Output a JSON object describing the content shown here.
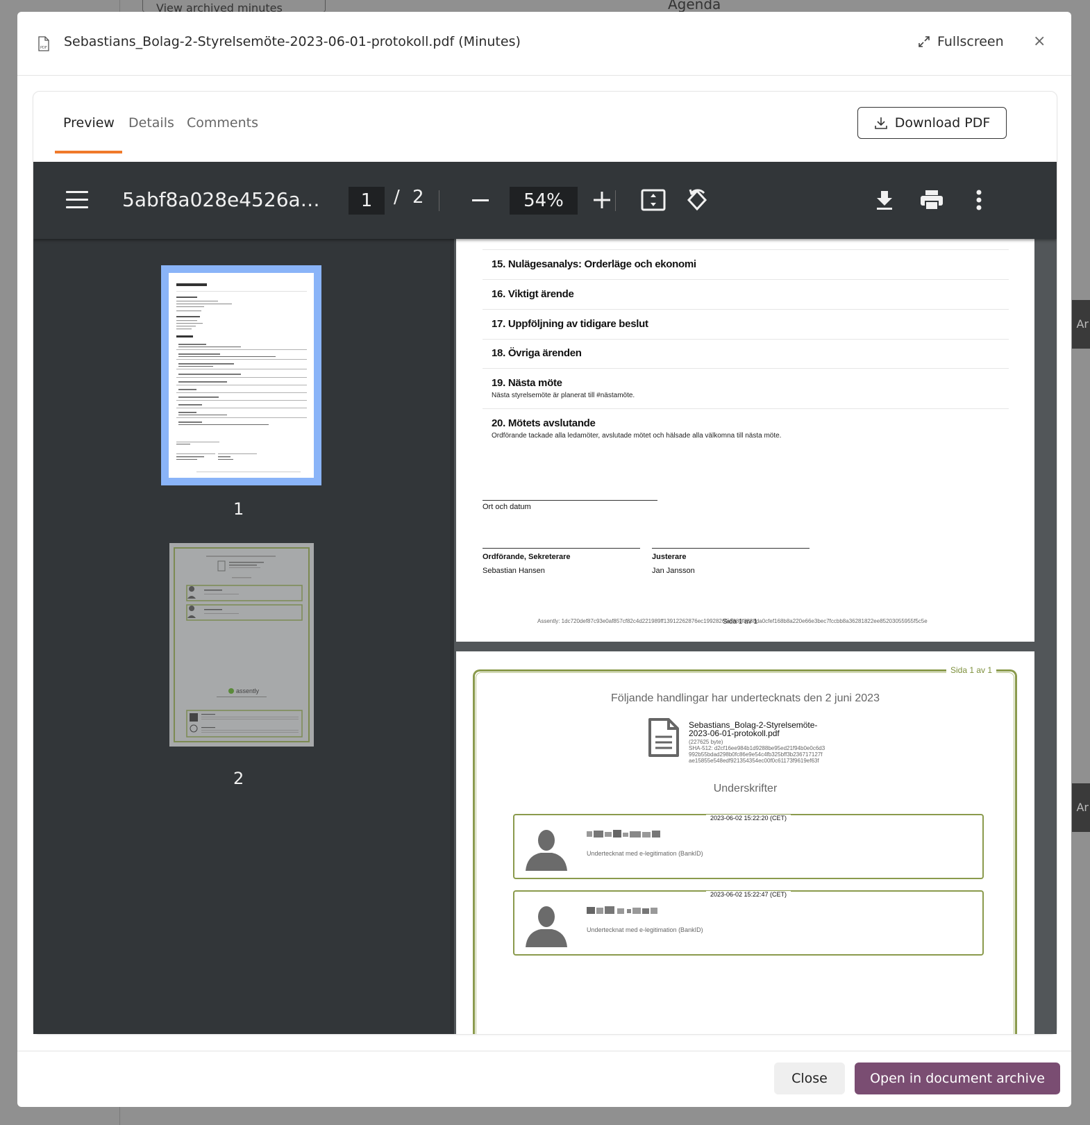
{
  "background": {
    "button_label": "View archived minutes",
    "heading": "Agenda",
    "right_tab_label": "Ar"
  },
  "modal": {
    "title": "Sebastians_Bolag-2-Styrelsemöte-2023-06-01-protokoll.pdf (Minutes)",
    "fullscreen_label": "Fullscreen",
    "close_icon": "×"
  },
  "tabs": [
    {
      "label": "Preview",
      "active": true
    },
    {
      "label": "Details",
      "active": false
    },
    {
      "label": "Comments",
      "active": false
    }
  ],
  "download_label": "Download PDF",
  "viewer": {
    "filename": "5abf8a028e4526a…",
    "current_page": "1",
    "separator": "/",
    "total_pages": "2",
    "zoom": "54%",
    "thumbnails": [
      {
        "number": "1",
        "selected": true
      },
      {
        "number": "2",
        "selected": false
      }
    ]
  },
  "page1": {
    "items": [
      {
        "heading": "15. Nulägesanalys: Orderläge och ekonomi",
        "text": ""
      },
      {
        "heading": "16. Viktigt ärende",
        "text": ""
      },
      {
        "heading": "17. Uppföljning av tidigare beslut",
        "text": ""
      },
      {
        "heading": "18. Övriga ärenden",
        "text": ""
      },
      {
        "heading": "19. Nästa möte",
        "text": "Nästa styrelsemöte är planerat till #nästamöte."
      },
      {
        "heading": "20. Mötets avslutande",
        "text": "Ordförande tackade alla ledamöter, avslutade mötet och hälsade alla välkomna till nästa möte."
      }
    ],
    "place_date_label": "Ort och datum",
    "sig1_role": "Ordförande, Sekreterare",
    "sig1_name": "Sebastian Hansen",
    "sig2_role": "Justerare",
    "sig2_name": "Jan Jansson",
    "assently_hash": "Assently: 1dc720def87c93e0af857cf82c4d221989ff13912262876ec1992826fa8880f8888da0cfef168b8a220e66e3bec7fccbb8a36281822ee85203055955f5c5e",
    "page_label": "Sida 1 av 1"
  },
  "page2": {
    "page_label": "Sida 1 av 1",
    "title": "Följande handlingar har undertecknats den 2 juni 2023",
    "doc_name_line1": "Sebastians_Bolag-2-Styrelsemöte-",
    "doc_name_line2": "2023-06-01-protokoll.pdf",
    "doc_size": "(227625 byte)",
    "sha_line1": "SHA-512: d2cf16ee984b1d9288be95ed21f94b0e0c6d3",
    "sha_line2": "992b55bdad298b0fc86e9e54c4fb325bff3b236717127f",
    "sha_line3": "ae15855e548edf921354354ec00f0c61173f9619ef63f",
    "subtitle": "Underskrifter",
    "signers": [
      {
        "timestamp": "2023-06-02 15:22:20 (CET)",
        "method": "Undertecknat med e-legitimation (BankID)"
      },
      {
        "timestamp": "2023-06-02 15:22:47 (CET)",
        "method": "Undertecknat med e-legitimation (BankID)"
      }
    ]
  },
  "footer": {
    "close_label": "Close",
    "open_archive_label": "Open in document archive"
  },
  "colors": {
    "tab_accent": "#f07a2b",
    "primary_button": "#7a4d72",
    "cert_green": "#8a9a4c",
    "thumb_selected": "#8ab4f8"
  }
}
